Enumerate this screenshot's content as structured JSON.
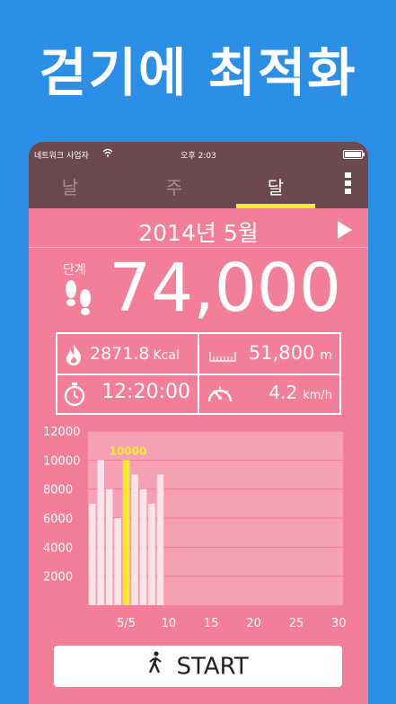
{
  "headline": "걷기에 최적화",
  "status_bar": {
    "carrier": "네트워크 사업자",
    "wifi_icon": "wifi-icon",
    "time": "오후 2:03",
    "battery_icon": "battery-icon"
  },
  "tabs": [
    {
      "label": "날",
      "active": false
    },
    {
      "label": "주",
      "active": false
    },
    {
      "label": "달",
      "active": true
    }
  ],
  "menu_icon": "vertical-menu-icon",
  "month": {
    "label": "2014년 5월",
    "next_icon": "next-arrow-icon"
  },
  "steps": {
    "label": "단계",
    "value": "74,000",
    "icon": "footprints-icon"
  },
  "stats": {
    "calories": {
      "value": "2871.8",
      "unit": "Kcal",
      "icon": "flame-icon"
    },
    "distance": {
      "value": "51,800",
      "unit": "m",
      "icon": "ruler-icon"
    },
    "duration": {
      "value": "12:20:00",
      "icon": "stopwatch-icon"
    },
    "speed": {
      "value": "4.2",
      "unit": "km/h",
      "icon": "speedometer-icon"
    }
  },
  "chart_data": {
    "type": "bar",
    "y_ticks": [
      "12000",
      "10000",
      "8000",
      "6000",
      "4000",
      "2000"
    ],
    "x_ticks": [
      "5/5",
      "10",
      "15",
      "20",
      "25",
      "30"
    ],
    "ylim": [
      0,
      12000
    ],
    "x": [
      1,
      2,
      3,
      4,
      5,
      6,
      7,
      8,
      9
    ],
    "values": [
      7000,
      10000,
      8000,
      6000,
      10000,
      9000,
      8000,
      7000,
      9000
    ],
    "highlight_index": 4,
    "highlight_label": "10000",
    "colors": {
      "bar": "#fbe4e9",
      "highlight": "#f3ec2a",
      "label": "#f3ec2a"
    }
  },
  "start_button": {
    "label": "START",
    "icon": "walking-person-icon"
  },
  "colors": {
    "background": "#2b8fe6",
    "panel": "#f27f97",
    "topbar": "#6b4a4f",
    "accent": "#f3ec2a"
  }
}
